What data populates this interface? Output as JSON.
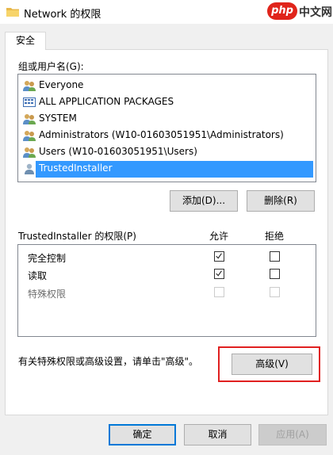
{
  "window": {
    "title": "Network 的权限"
  },
  "watermark": {
    "badge": "php",
    "text": "中文网"
  },
  "tabs": [
    {
      "label": "安全"
    }
  ],
  "groups": {
    "label": "组或用户名(G):",
    "items": [
      {
        "name": "Everyone",
        "icon": "users-icon"
      },
      {
        "name": "ALL APPLICATION PACKAGES",
        "icon": "packages-icon"
      },
      {
        "name": "SYSTEM",
        "icon": "users-icon"
      },
      {
        "name": "Administrators (W10-01603051951\\Administrators)",
        "icon": "users-icon"
      },
      {
        "name": "Users (W10-01603051951\\Users)",
        "icon": "users-icon"
      },
      {
        "name": "TrustedInstaller",
        "icon": "user-icon",
        "selected": true
      }
    ],
    "add_button": "添加(D)...",
    "remove_button": "删除(R)"
  },
  "permissions": {
    "label": "TrustedInstaller 的权限(P)",
    "allow_header": "允许",
    "deny_header": "拒绝",
    "rows": [
      {
        "name": "完全控制",
        "allow": true,
        "deny": false,
        "disabled": false
      },
      {
        "name": "读取",
        "allow": true,
        "deny": false,
        "disabled": false
      },
      {
        "name": "特殊权限",
        "allow": false,
        "deny": false,
        "disabled": true
      }
    ]
  },
  "advanced": {
    "hint": "有关特殊权限或高级设置，请单击\"高级\"。",
    "button": "高级(V)"
  },
  "footer": {
    "ok": "确定",
    "cancel": "取消",
    "apply": "应用(A)"
  },
  "colors": {
    "selection": "#3399ff",
    "highlight_box": "#e02020",
    "default_button_border": "#0078d7"
  }
}
